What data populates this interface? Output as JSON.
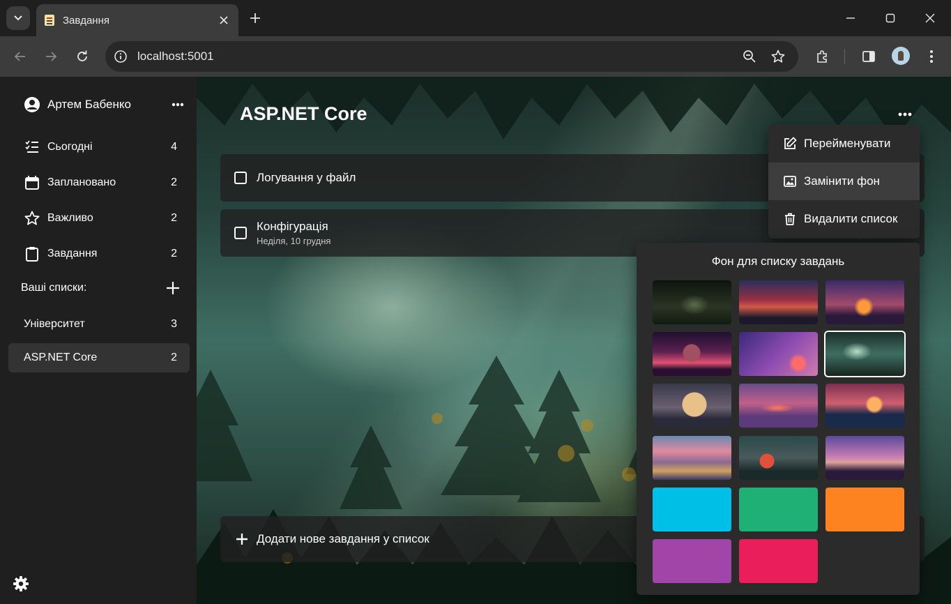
{
  "browser": {
    "tab_title": "Завдання",
    "url": "localhost:5001"
  },
  "sidebar": {
    "user_name": "Артем Бабенко",
    "nav": [
      {
        "icon": "checklist-icon",
        "label": "Сьогодні",
        "count": "4"
      },
      {
        "icon": "calendar-icon",
        "label": "Заплановано",
        "count": "2"
      },
      {
        "icon": "star-icon",
        "label": "Важливо",
        "count": "2"
      },
      {
        "icon": "clipboard-icon",
        "label": "Завдання",
        "count": "2"
      }
    ],
    "lists_header": "Ваші списки:",
    "lists": [
      {
        "label": "Університет",
        "count": "3"
      },
      {
        "label": "ASP.NET Core",
        "count": "2"
      }
    ]
  },
  "main": {
    "list_title": "ASP.NET Core",
    "tasks": [
      {
        "title": "Логування у файл",
        "subtitle": ""
      },
      {
        "title": "Конфігурація",
        "subtitle": "Неділя, 10 грудня"
      }
    ],
    "add_task_label": "Додати нове завдання у список"
  },
  "context_menu": {
    "items": [
      {
        "icon": "edit-icon",
        "label": "Перейменувати"
      },
      {
        "icon": "image-icon",
        "label": "Замінити фон"
      },
      {
        "icon": "trash-icon",
        "label": "Видалити список"
      }
    ]
  },
  "background_picker": {
    "title": "Фон для списку завдань",
    "solid_colors": [
      "#00bfe6",
      "#1fb075",
      "#fd8321",
      "#a245a8",
      "#e91e5a"
    ],
    "selected_index": 5
  }
}
